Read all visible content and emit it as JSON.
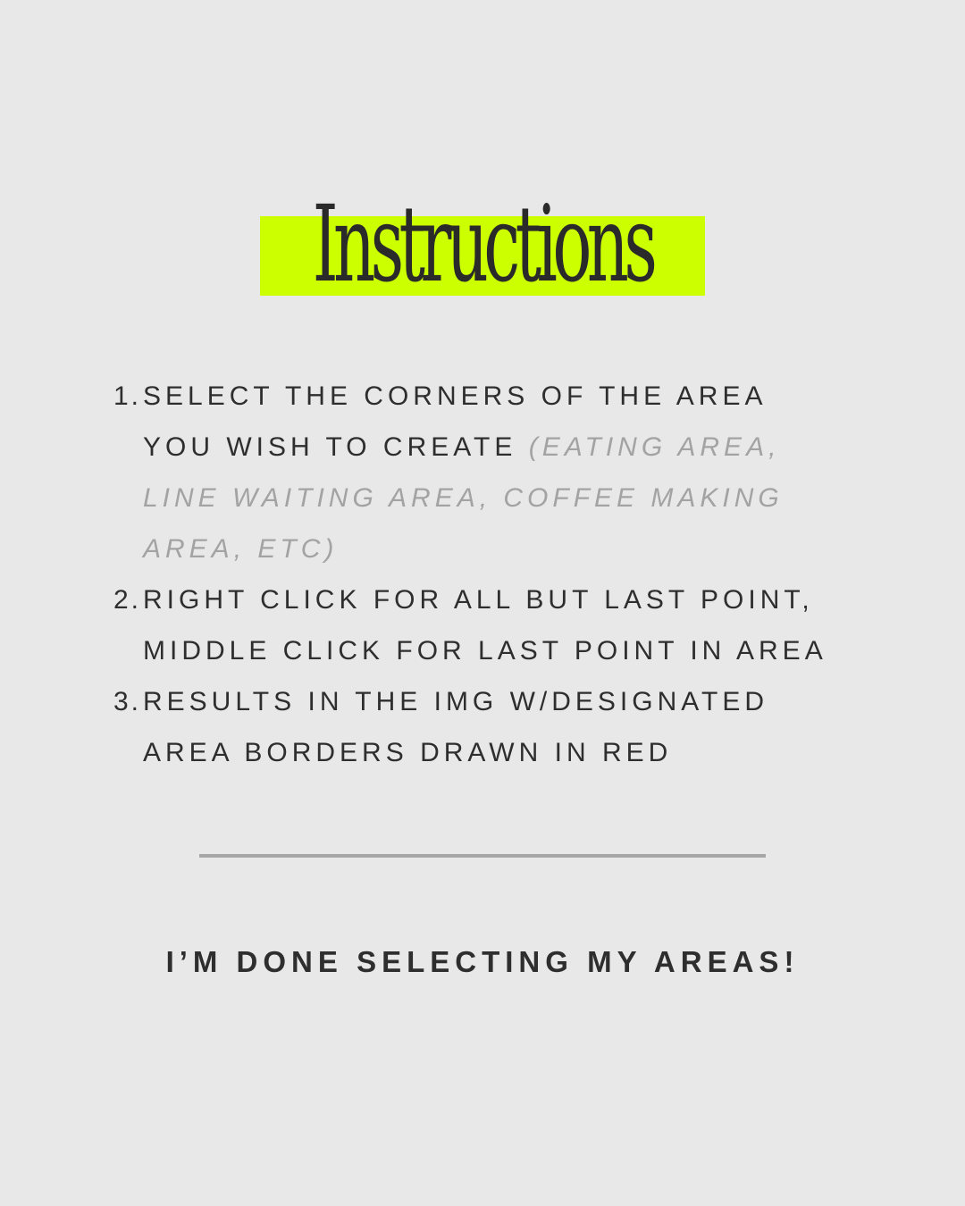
{
  "title": "Instructions",
  "steps": [
    {
      "number": "1.",
      "lines": [
        "SELECT THE CORNERS OF THE AREA",
        "YOU WISH TO CREATE "
      ],
      "aside_first": "(EATING AREA,",
      "aside_lines": [
        "LINE WAITING AREA, COFFEE MAKING",
        "AREA, ETC)"
      ]
    },
    {
      "number": "2.",
      "lines": [
        "RIGHT CLICK FOR ALL BUT LAST POINT,",
        "MIDDLE CLICK FOR LAST POINT IN AREA"
      ]
    },
    {
      "number": "3.",
      "lines": [
        "RESULTS IN THE IMG W/DESIGNATED",
        "AREA BORDERS DRAWN IN RED"
      ]
    }
  ],
  "done_label": "I’M DONE SELECTING MY AREAS!",
  "colors": {
    "background": "#e8e8e8",
    "highlight": "#ccff00",
    "text": "#2e2e2e",
    "muted": "#a3a3a3",
    "divider": "#a6a6a6"
  }
}
